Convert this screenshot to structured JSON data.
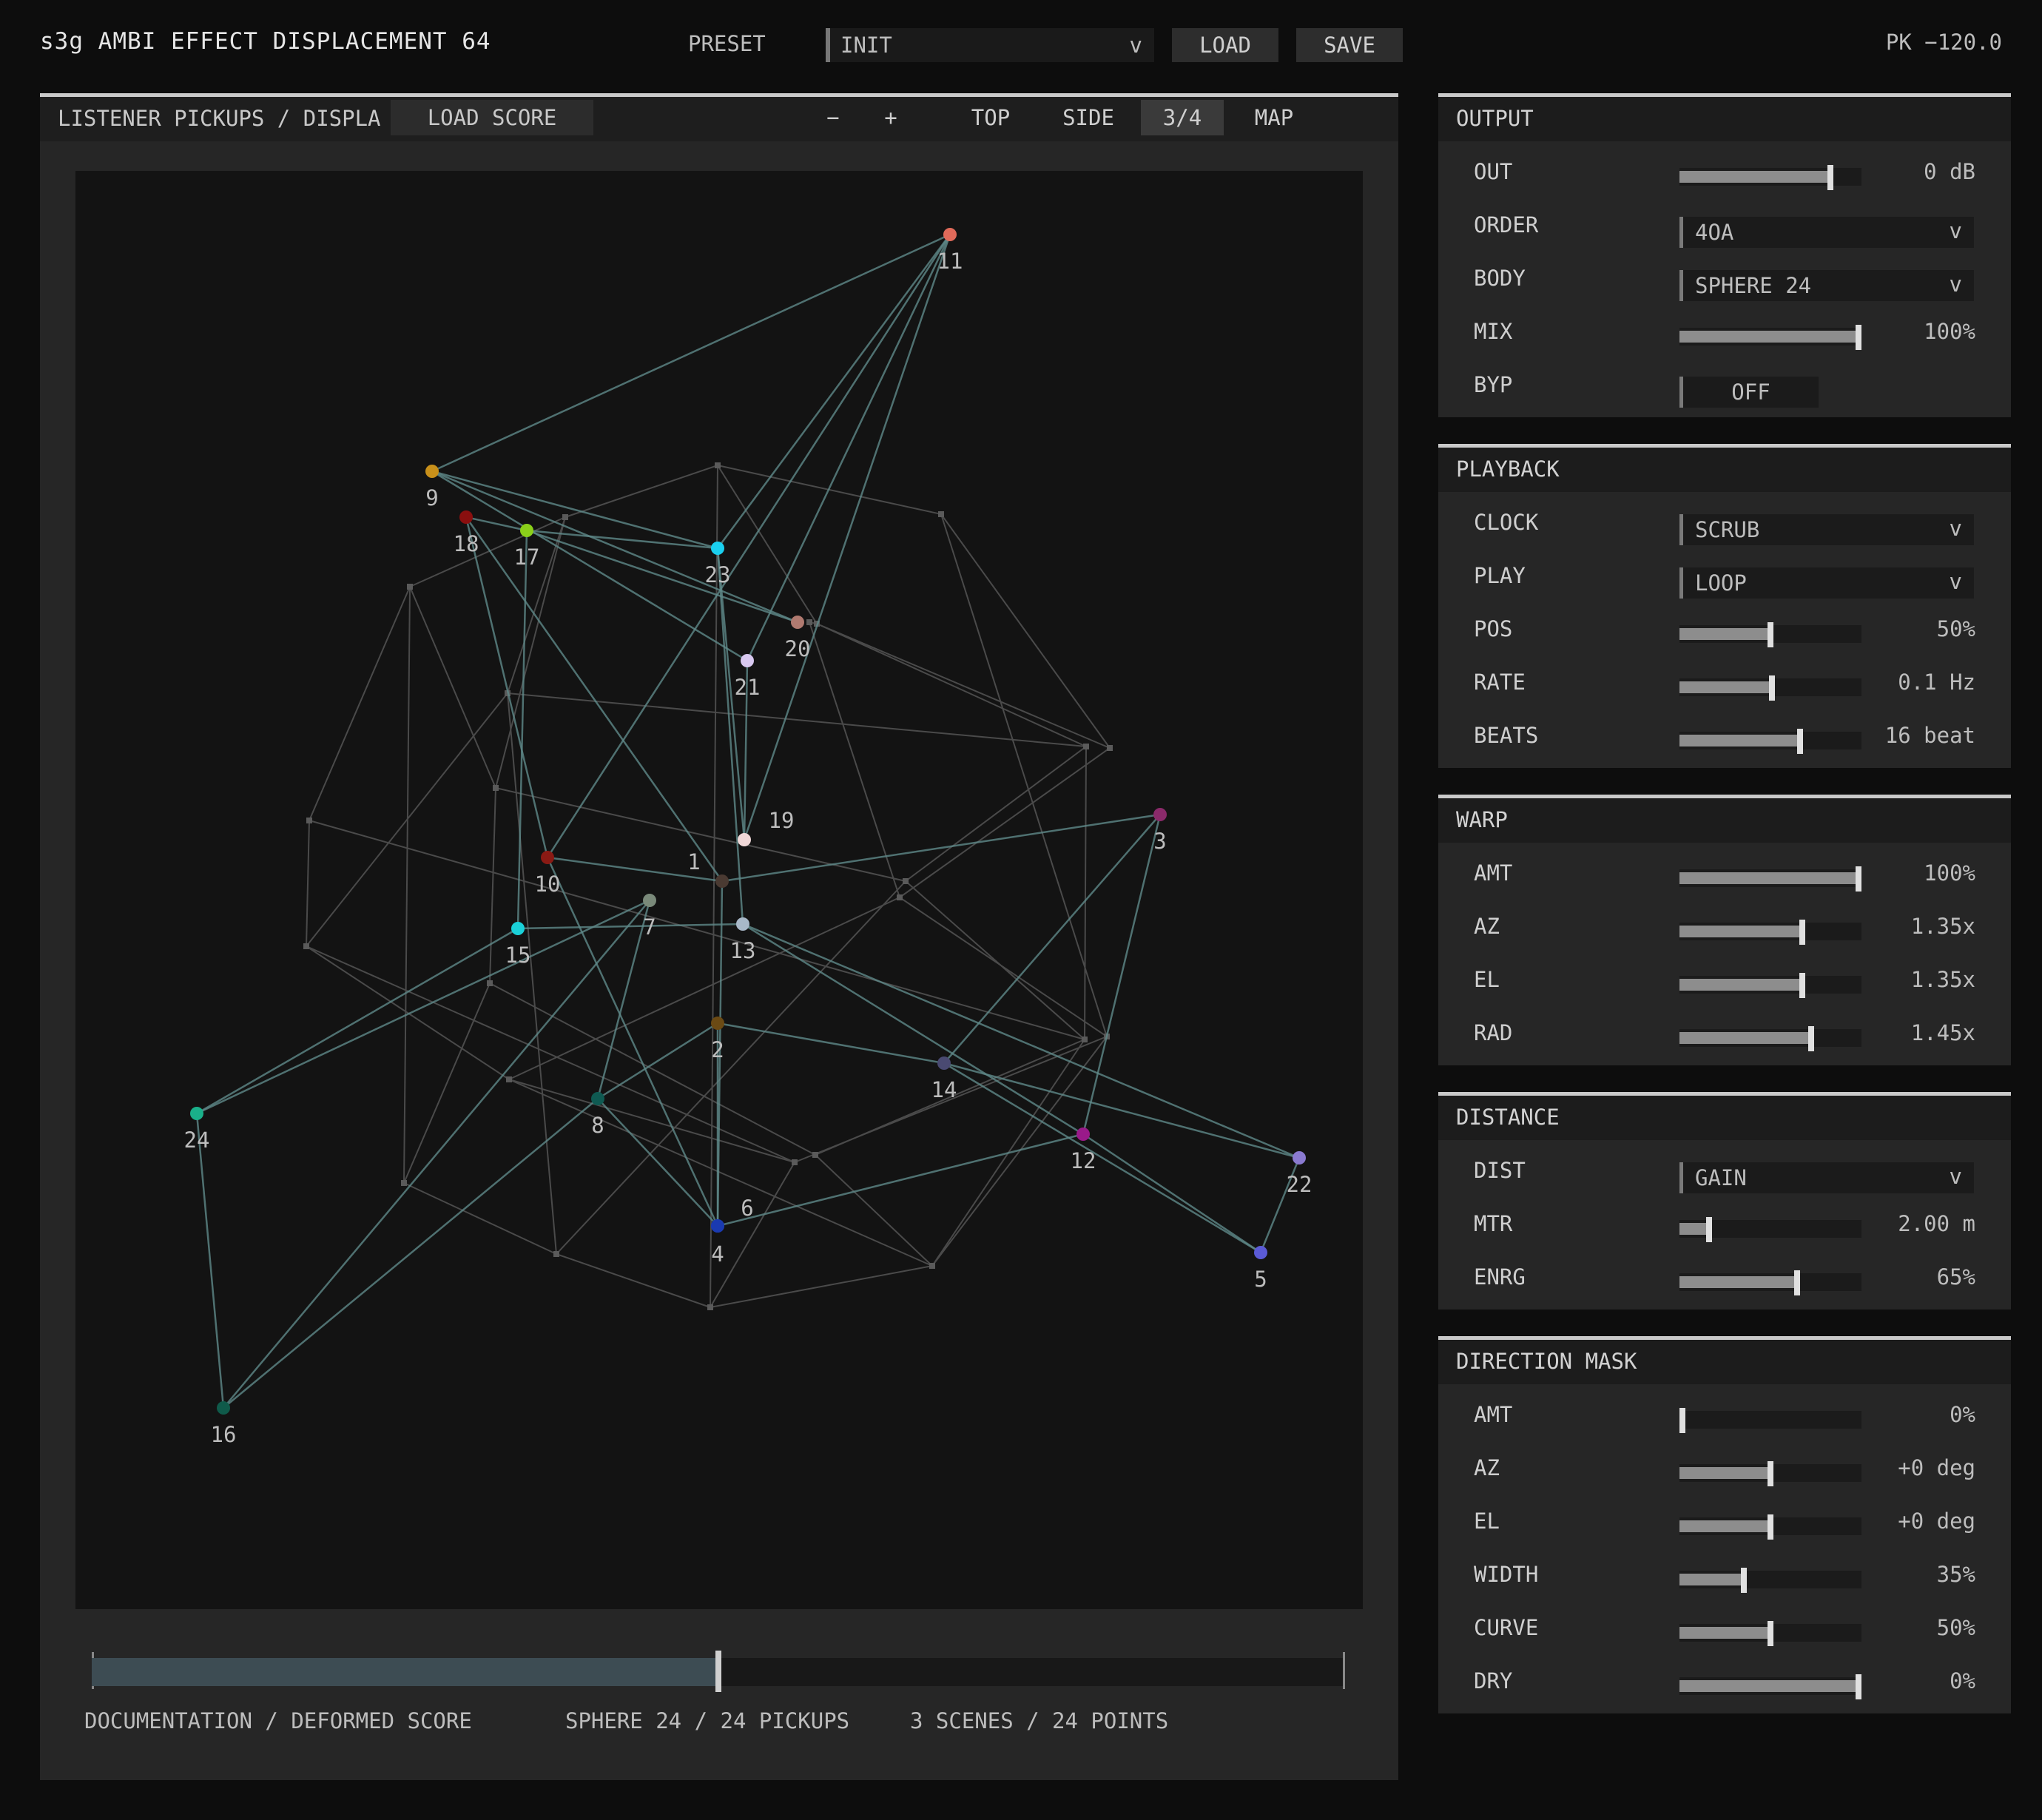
{
  "app": {
    "title": "s3g AMBI EFFECT DISPLACEMENT 64",
    "peak": "PK −120.0"
  },
  "preset": {
    "label": "PRESET",
    "value": "INIT",
    "chevron": "v",
    "load": "LOAD",
    "save": "SAVE"
  },
  "viewport": {
    "title": "LISTENER PICKUPS / DISPLA",
    "load_score": "LOAD SCORE",
    "zoom_out": "−",
    "zoom_in": "+",
    "views": [
      "TOP",
      "SIDE",
      "3/4",
      "MAP"
    ],
    "active_view": "3/4"
  },
  "scrub": {
    "position": 0.5
  },
  "footer": {
    "mode": "DOCUMENTATION / DEFORMED SCORE",
    "body": "SPHERE 24 / 24 PICKUPS",
    "scenes": "3 SCENES / 24 POINTS"
  },
  "sections": {
    "output": {
      "title": "OUTPUT",
      "out": {
        "label": "OUT",
        "value": "0 dB",
        "level": 0.84
      },
      "order": {
        "label": "ORDER",
        "value": "4OA",
        "chevron": "v"
      },
      "body": {
        "label": "BODY",
        "value": "SPHERE 24",
        "chevron": "v"
      },
      "mix": {
        "label": "MIX",
        "value": "100%",
        "level": 1.0
      },
      "byp": {
        "label": "BYP",
        "value": "OFF"
      }
    },
    "playback": {
      "title": "PLAYBACK",
      "clock": {
        "label": "CLOCK",
        "value": "SCRUB",
        "chevron": "v"
      },
      "play": {
        "label": "PLAY",
        "value": "LOOP",
        "chevron": "v"
      },
      "pos": {
        "label": "POS",
        "value": "50%",
        "level": 0.5
      },
      "rate": {
        "label": "RATE",
        "value": "0.1 Hz",
        "level": 0.51
      },
      "beats": {
        "label": "BEATS",
        "value": "16 beat",
        "level": 0.67
      }
    },
    "warp": {
      "title": "WARP",
      "amt": {
        "label": "AMT",
        "value": "100%",
        "level": 1.0
      },
      "az": {
        "label": "AZ",
        "value": "1.35x",
        "level": 0.68
      },
      "el": {
        "label": "EL",
        "value": "1.35x",
        "level": 0.68
      },
      "rad": {
        "label": "RAD",
        "value": "1.45x",
        "level": 0.73
      }
    },
    "distance": {
      "title": "DISTANCE",
      "dist": {
        "label": "DIST",
        "value": "GAIN",
        "chevron": "v"
      },
      "mtr": {
        "label": "MTR",
        "value": "2.00 m",
        "level": 0.15
      },
      "enrg": {
        "label": "ENRG",
        "value": "65%",
        "level": 0.65
      }
    },
    "mask": {
      "title": "DIRECTION MASK",
      "amt": {
        "label": "AMT",
        "value": "0%",
        "level": 0.0
      },
      "az": {
        "label": "AZ",
        "value": "+0 deg",
        "level": 0.5
      },
      "el": {
        "label": "EL",
        "value": "+0 deg",
        "level": 0.5
      },
      "width": {
        "label": "WIDTH",
        "value": "35%",
        "level": 0.35
      },
      "curve": {
        "label": "CURVE",
        "value": "50%",
        "level": 0.5
      },
      "dry": {
        "label": "DRY",
        "value": "0%",
        "level": 1.0
      }
    }
  },
  "pickups": [
    {
      "id": "1",
      "color": "#4a3a32"
    },
    {
      "id": "2",
      "color": "#6b4a14"
    },
    {
      "id": "3",
      "color": "#8a2a6a"
    },
    {
      "id": "4",
      "color": "#1a3ab0"
    },
    {
      "id": "5",
      "color": "#5a5ad6"
    },
    {
      "id": "6",
      "color": "#1a3ab0"
    },
    {
      "id": "7",
      "color": "#7a8a7a"
    },
    {
      "id": "8",
      "color": "#0f5a52"
    },
    {
      "id": "9",
      "color": "#c8901a"
    },
    {
      "id": "10",
      "color": "#8a1a14"
    },
    {
      "id": "11",
      "color": "#e06a5a"
    },
    {
      "id": "12",
      "color": "#9a1a8a"
    },
    {
      "id": "13",
      "color": "#a8b8c8"
    },
    {
      "id": "14",
      "color": "#4a4a72"
    },
    {
      "id": "15",
      "color": "#1ad0d8"
    },
    {
      "id": "16",
      "color": "#0f5a4a"
    },
    {
      "id": "17",
      "color": "#8ad01a"
    },
    {
      "id": "18",
      "color": "#8a0f0f"
    },
    {
      "id": "19",
      "color": "#f0d8d8"
    },
    {
      "id": "20",
      "color": "#b07a70"
    },
    {
      "id": "21",
      "color": "#d8c8f0"
    },
    {
      "id": "22",
      "color": "#8a7ad0"
    },
    {
      "id": "23",
      "color": "#1ad0f0"
    },
    {
      "id": "24",
      "color": "#1ab08a"
    }
  ],
  "colors": {
    "link": "#5f8a8a",
    "wire": "#4a4a4a",
    "label": "#bdbdbd"
  }
}
